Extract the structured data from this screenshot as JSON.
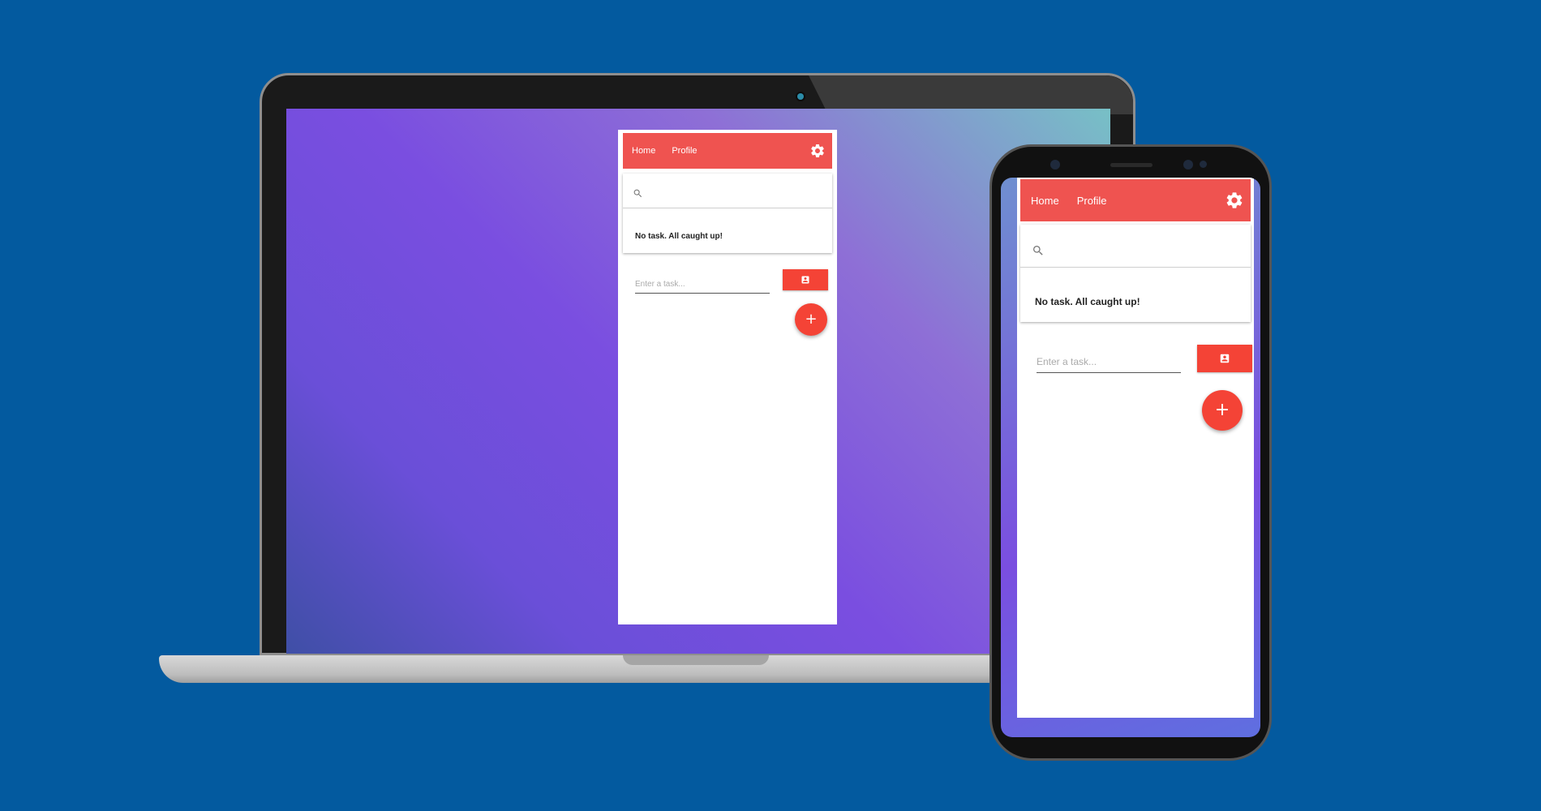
{
  "colors": {
    "background": "#035a9f",
    "accent": "#ef5350",
    "button": "#f44336"
  },
  "laptop_app": {
    "nav": {
      "home_label": "Home",
      "profile_label": "Profile",
      "settings_icon": "gear-icon"
    },
    "search": {
      "icon": "search-icon",
      "value": "",
      "placeholder": ""
    },
    "task_list": {
      "empty_message": "No task. All caught up!"
    },
    "task_form": {
      "placeholder": "Enter a task...",
      "contact_icon": "contact-card-icon",
      "add_label": "+"
    }
  },
  "phone_app": {
    "nav": {
      "home_label": "Home",
      "profile_label": "Profile",
      "settings_icon": "gear-icon"
    },
    "search": {
      "icon": "search-icon",
      "value": "",
      "placeholder": ""
    },
    "task_list": {
      "empty_message": "No task. All caught up!"
    },
    "task_form": {
      "placeholder": "Enter a task...",
      "contact_icon": "contact-card-icon",
      "add_label": "+"
    }
  }
}
